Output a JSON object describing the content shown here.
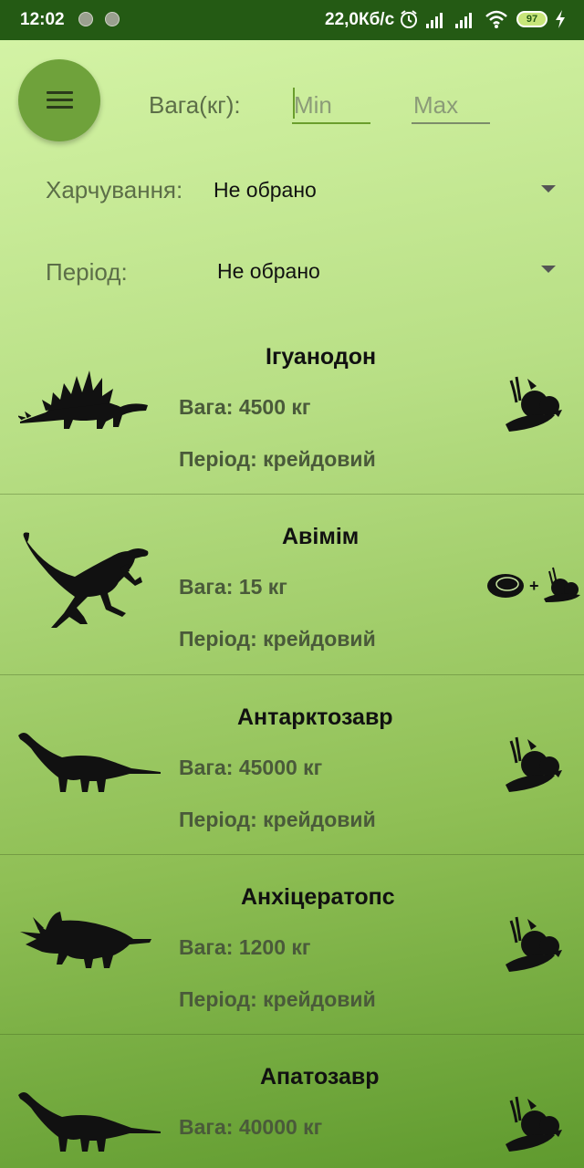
{
  "status_bar": {
    "time": "12:02",
    "network_speed": "22,0Кб/с",
    "battery_level": "97"
  },
  "filters": {
    "weight_label": "Вага(кг):",
    "min_placeholder": "Min",
    "max_placeholder": "Max",
    "diet_label": "Харчування:",
    "diet_value": "Не обрано",
    "period_label": "Період:",
    "period_value": "Не обрано"
  },
  "dinosaurs": [
    {
      "name": "Ігуанодон",
      "weight": "Вага: 4500 кг",
      "period": "Період: крейдовий",
      "silhouette": "stegosaurus-icon",
      "diet_icon": "plants-icon"
    },
    {
      "name": "Авімім",
      "weight": "Вага: 15 кг",
      "period": "Період: крейдовий",
      "silhouette": "raptor-icon",
      "diet_icon": "meat-plus-plants-icon"
    },
    {
      "name": "Антарктозавр",
      "weight": "Вага: 45000 кг",
      "period": "Період: крейдовий",
      "silhouette": "sauropod-icon",
      "diet_icon": "plants-icon"
    },
    {
      "name": "Анхіцератопс",
      "weight": "Вага: 1200 кг",
      "period": "Період: крейдовий",
      "silhouette": "triceratops-icon",
      "diet_icon": "plants-icon"
    },
    {
      "name": "Апатозавр",
      "weight": "Вага: 40000 кг",
      "period": "",
      "silhouette": "sauropod-icon",
      "diet_icon": "plants-icon"
    }
  ]
}
